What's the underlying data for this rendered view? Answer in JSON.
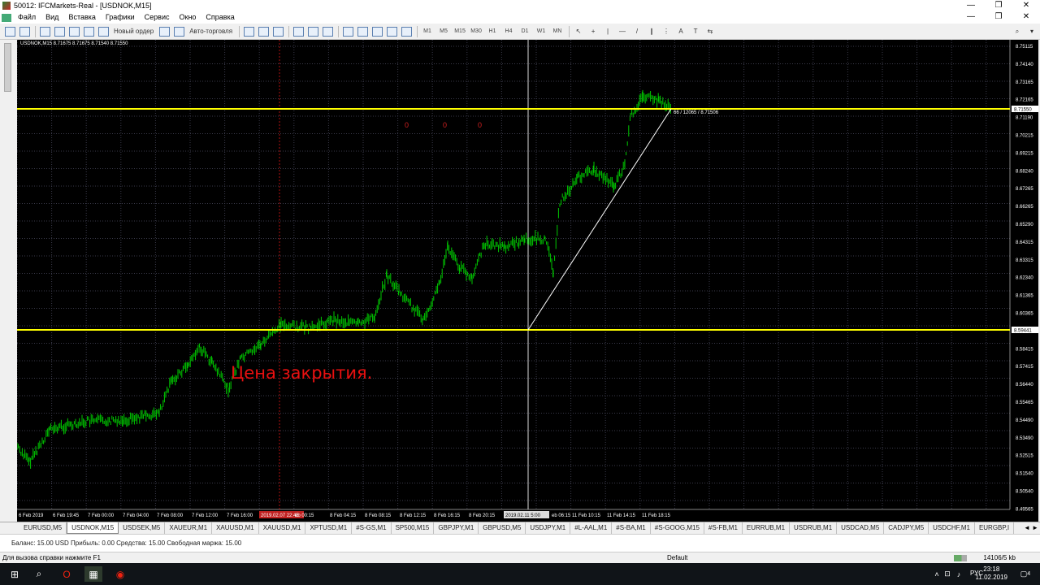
{
  "window": {
    "title": "50012: IFCMarkets-Real - [USDNOK,M15]",
    "minimize": "—",
    "maximize": "❐",
    "close": "✕"
  },
  "menu": [
    "Файл",
    "Вид",
    "Вставка",
    "Графики",
    "Сервис",
    "Окно",
    "Справка"
  ],
  "mdi_controls": {
    "minimize": "—",
    "restore": "❐",
    "close": "✕"
  },
  "toolbar": {
    "new_order": "Новый ордер",
    "autotrading": "Авто-торговля",
    "timeframes": [
      "M1",
      "M5",
      "M15",
      "M30",
      "H1",
      "H4",
      "D1",
      "W1",
      "MN"
    ]
  },
  "chart": {
    "symbol_header": "USDNOK,M15  8.71675 8.71675 8.71540 8.71550",
    "annotation": "Цена закрытия.",
    "zero_marks": [
      "0",
      "0",
      "0"
    ],
    "fibo_label": "66 / 12065 / 8.71506",
    "line_price_upper": "8.71550",
    "line_price_lower": "8.59441",
    "price_levels": [
      "8.75115",
      "8.74140",
      "8.73165",
      "8.72165",
      "8.71190",
      "8.70215",
      "8.69215",
      "8.68240",
      "8.67265",
      "8.66265",
      "8.65290",
      "8.64315",
      "8.63315",
      "8.62340",
      "8.61365",
      "8.60365",
      "8.59390",
      "8.58415",
      "8.57415",
      "8.56440",
      "8.55465",
      "8.54490",
      "8.53490",
      "8.52515",
      "8.51540",
      "8.50540",
      "8.49565"
    ],
    "time_labels": [
      "6 Feb 2019",
      "6 Feb 19:45",
      "7 Feb 00:00",
      "7 Feb 04:00",
      "7 Feb 08:00",
      "7 Feb 12:00",
      "7 Feb 16:00",
      "2019.02.07 22:45",
      "eb 00:15",
      "8 Feb 04:15",
      "8 Feb 08:15",
      "8 Feb 12:15",
      "8 Feb 16:15",
      "8 Feb 20:15",
      "2019.02.11 5:00",
      "eb 06:15",
      "11 Feb 10:15",
      "11 Feb 14:15",
      "11 Feb 18:15"
    ]
  },
  "tabs": [
    "EURUSD,M5",
    "USDNOK,M15",
    "USDSEK,M5",
    "XAUEUR,M1",
    "XAUUSD,M1",
    "XAUUSD,M1",
    "XPTUSD,M1",
    "#S-GS,M1",
    "SP500,M15",
    "GBPJPY,M1",
    "GBPUSD,M5",
    "USDJPY,M1",
    "#L-AAL,M1",
    "#S-BA,M1",
    "#S-GOOG,M15",
    "#S-FB,M1",
    "EURRUB,M1",
    "USDRUB,M1",
    "USDCAD,M5",
    "CADJPY,M5",
    "USDCHF,M1",
    "EURGBP,I"
  ],
  "tab_arrows": "◄ ►",
  "balance_line": "Баланс: 15.00 USD  Прибыль: 0.00  Средства: 15.00  Свободная маржа: 15.00",
  "status": {
    "help": "Для вызова справки нажмите F1",
    "profile": "Default",
    "traffic": "14106/5 kb"
  },
  "taskbar": {
    "lang": "РУС",
    "time": "23:18",
    "date": "11.02.2019",
    "notifications": "4"
  },
  "colors": {
    "chart_bg": "#000000",
    "candles": "#00c800",
    "hline": "#ffff00",
    "grid": "#3a3a4a"
  }
}
